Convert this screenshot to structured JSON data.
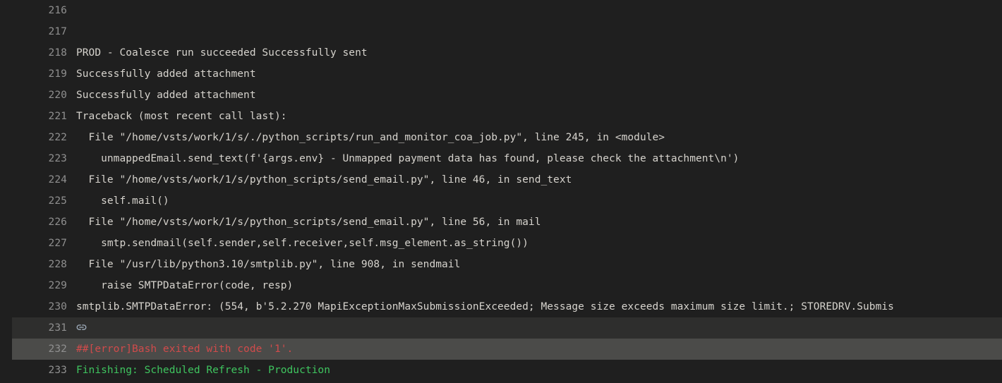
{
  "viewer": {
    "name": "pipeline-log-viewer",
    "theme": "dark",
    "background_color": "#1f1f1f",
    "text_color": "#d6d3cd",
    "line_number_color": "#8f8f8f",
    "error_color": "#d14b4b",
    "success_color": "#3fc55f",
    "highlight_soft_color": "#2e2e2d",
    "highlight_strong_color": "#4b4b49"
  },
  "lines": [
    {
      "number": "216",
      "text": "",
      "style": "default",
      "highlight": "none",
      "icon": ""
    },
    {
      "number": "217",
      "text": "",
      "style": "default",
      "highlight": "none",
      "icon": ""
    },
    {
      "number": "218",
      "text": "PROD - Coalesce run succeeded Successfully sent",
      "style": "default",
      "highlight": "none",
      "icon": ""
    },
    {
      "number": "219",
      "text": "Successfully added attachment",
      "style": "default",
      "highlight": "none",
      "icon": ""
    },
    {
      "number": "220",
      "text": "Successfully added attachment",
      "style": "default",
      "highlight": "none",
      "icon": ""
    },
    {
      "number": "221",
      "text": "Traceback (most recent call last):",
      "style": "default",
      "highlight": "none",
      "icon": ""
    },
    {
      "number": "222",
      "text": "  File \"/home/vsts/work/1/s/./python_scripts/run_and_monitor_coa_job.py\", line 245, in <module>",
      "style": "default",
      "highlight": "none",
      "icon": ""
    },
    {
      "number": "223",
      "text": "    unmappedEmail.send_text(f'{args.env} - Unmapped payment data has found, please check the attachment\\n')",
      "style": "default",
      "highlight": "none",
      "icon": ""
    },
    {
      "number": "224",
      "text": "  File \"/home/vsts/work/1/s/python_scripts/send_email.py\", line 46, in send_text",
      "style": "default",
      "highlight": "none",
      "icon": ""
    },
    {
      "number": "225",
      "text": "    self.mail()",
      "style": "default",
      "highlight": "none",
      "icon": ""
    },
    {
      "number": "226",
      "text": "  File \"/home/vsts/work/1/s/python_scripts/send_email.py\", line 56, in mail",
      "style": "default",
      "highlight": "none",
      "icon": ""
    },
    {
      "number": "227",
      "text": "    smtp.sendmail(self.sender,self.receiver,self.msg_element.as_string())",
      "style": "default",
      "highlight": "none",
      "icon": ""
    },
    {
      "number": "228",
      "text": "  File \"/usr/lib/python3.10/smtplib.py\", line 908, in sendmail",
      "style": "default",
      "highlight": "none",
      "icon": ""
    },
    {
      "number": "229",
      "text": "    raise SMTPDataError(code, resp)",
      "style": "default",
      "highlight": "none",
      "icon": ""
    },
    {
      "number": "230",
      "text": "smtplib.SMTPDataError: (554, b'5.2.270 MapiExceptionMaxSubmissionExceeded; Message size exceeds maximum size limit.; STOREDRV.Submis",
      "style": "default",
      "highlight": "none",
      "icon": ""
    },
    {
      "number": "231",
      "text": "",
      "style": "default",
      "highlight": "soft",
      "icon": "link-icon"
    },
    {
      "number": "232",
      "text": "##[error]Bash exited with code '1'.",
      "style": "error",
      "highlight": "strong",
      "icon": ""
    },
    {
      "number": "233",
      "text": "Finishing: Scheduled Refresh - Production",
      "style": "success",
      "highlight": "none",
      "icon": ""
    }
  ]
}
